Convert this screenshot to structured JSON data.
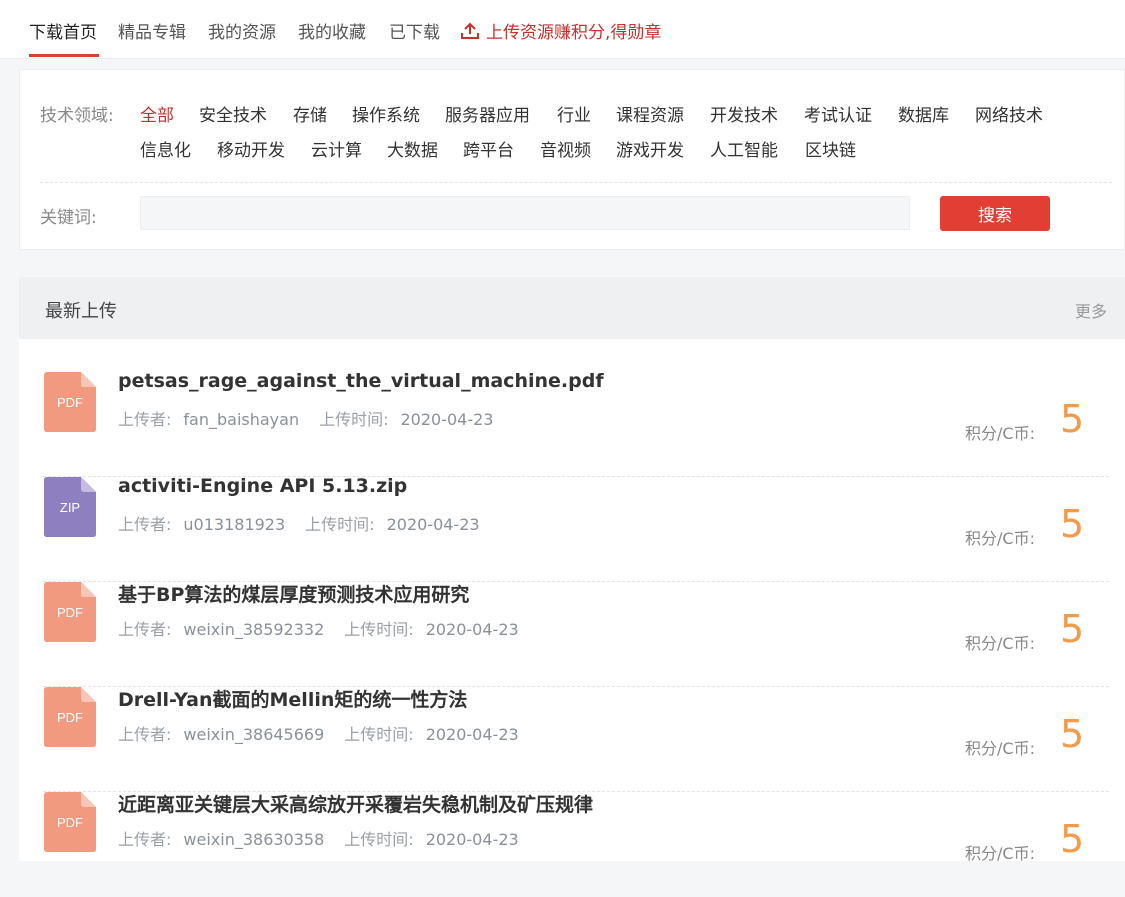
{
  "nav": {
    "tabs": [
      "下载首页",
      "精品专辑",
      "我的资源",
      "我的收藏",
      "已下载"
    ],
    "upload_label": "上传资源赚积分,得勋章",
    "upload_icon": "upload-icon"
  },
  "filter": {
    "domain_label": "技术领域:",
    "categories": [
      "全部",
      "安全技术",
      "存储",
      "操作系统",
      "服务器应用",
      "行业",
      "课程资源",
      "开发技术",
      "考试认证",
      "数据库",
      "网络技术",
      "信息化",
      "移动开发",
      "云计算",
      "大数据",
      "跨平台",
      "音视频",
      "游戏开发",
      "人工智能",
      "区块链"
    ],
    "active_category": "全部",
    "keyword_label": "关键词:",
    "keyword_value": "",
    "search_label": "搜索"
  },
  "latest": {
    "title": "最新上传",
    "more_label": "更多",
    "uploader_label": "上传者:",
    "time_label": "上传时间:",
    "price_label": "积分/C币:",
    "items": [
      {
        "type": "PDF",
        "name": "petsas_rage_against_the_virtual_machine.pdf",
        "uploader": "fan_baishayan",
        "time": "2020-04-23",
        "price": "5"
      },
      {
        "type": "ZIP",
        "name": "activiti-Engine API 5.13.zip",
        "uploader": "u013181923",
        "time": "2020-04-23",
        "price": "5"
      },
      {
        "type": "PDF",
        "name": "基于BP算法的煤层厚度预测技术应用研究",
        "uploader": "weixin_38592332",
        "time": "2020-04-23",
        "price": "5"
      },
      {
        "type": "PDF",
        "name": "Drell-Yan截面的Mellin矩的统一性方法",
        "uploader": "weixin_38645669",
        "time": "2020-04-23",
        "price": "5"
      },
      {
        "type": "PDF",
        "name": "近距离亚关键层大采高综放开采覆岩失稳机制及矿压规律",
        "uploader": "weixin_38630358",
        "time": "2020-04-23",
        "price": "5"
      }
    ]
  },
  "colors": {
    "accent": "#e33e33",
    "pdf": "#f19a80",
    "zip": "#8e80c0",
    "price": "#f39a4b"
  }
}
